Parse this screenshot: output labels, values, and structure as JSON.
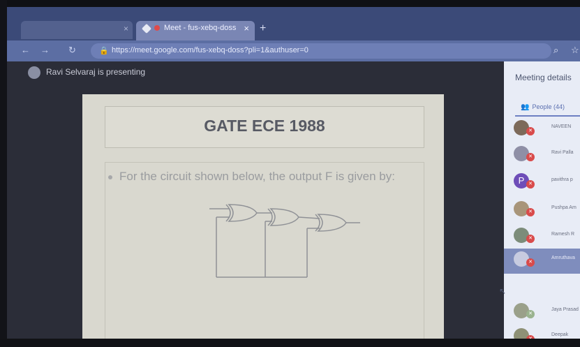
{
  "browser": {
    "active_tab_title": "Meet - fus-xebq-doss",
    "new_tab_symbol": "+",
    "close_symbol": "×",
    "url": "https://meet.google.com/fus-xebq-doss?pli=1&authuser=0"
  },
  "meet": {
    "presenting_text": "Ravi Selvaraj is presenting"
  },
  "slide": {
    "title": "GATE ECE 1988",
    "bullet": "For the circuit shown below, the output F is given by:"
  },
  "panel": {
    "title": "Meeting details",
    "people_tab": "People (44)",
    "participants": [
      {
        "name": "NAVEEN",
        "initial": "",
        "color": "#7d6a5a"
      },
      {
        "name": "Ravi Palla",
        "initial": "",
        "color": "#8f8fa6"
      },
      {
        "name": "pavithra p",
        "initial": "P",
        "color": "#6e4db8"
      },
      {
        "name": "Pushpa Am",
        "initial": "",
        "color": "#a8957a"
      },
      {
        "name": "Ramesh R",
        "initial": "",
        "color": "#7c8c7a"
      },
      {
        "name": "Amruthava",
        "initial": "",
        "color": "#c7cbe0"
      },
      {
        "name": "Jaya Prasad",
        "initial": "",
        "color": "#9aa08a"
      },
      {
        "name": "Deepak",
        "initial": "",
        "color": "#8e9176"
      }
    ]
  },
  "colors": {
    "accent": "#3b4a78",
    "mic_muted": "#d94b4b"
  }
}
